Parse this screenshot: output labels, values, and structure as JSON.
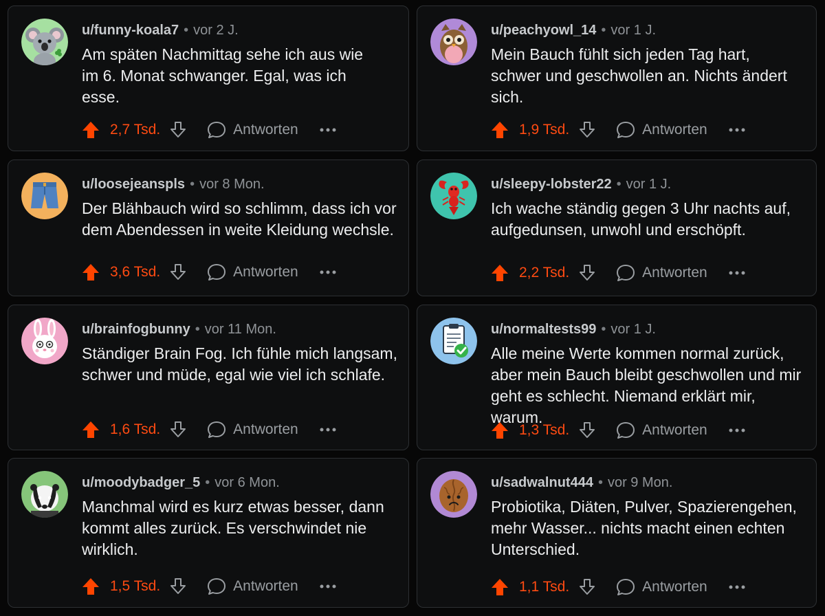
{
  "theme": {
    "accent": "#ff4500",
    "background": "#070707",
    "card": "#0e0f10",
    "border": "#2d3033"
  },
  "comments": [
    {
      "user": "u/funny-koala7",
      "time": "vor 2 J.",
      "lines": [
        "Am späten Nachmittag sehe ich aus wie",
        "im 6. Monat schwanger. Egal, was ich",
        "esse."
      ],
      "votes": "2,7 Tsd.",
      "reply": "Antworten",
      "avatar": "koala-icon"
    },
    {
      "user": "u/peachyowl_14",
      "time": "vor 1 J.",
      "lines": [
        "Mein Bauch fühlt sich jeden Tag hart,",
        "schwer und geschwollen an. Nichts ändert",
        "sich."
      ],
      "votes": "1,9 Tsd.",
      "reply": "Antworten",
      "avatar": "owl-icon"
    },
    {
      "user": "u/loosejeanspls",
      "time": "vor 8 Mon.",
      "lines": [
        "Der Blähbauch wird so schlimm, dass ich vor",
        "dem Abendessen in weite Kleidung wechsle."
      ],
      "votes": "3,6 Tsd.",
      "reply": "Antworten",
      "avatar": "jeans-shorts-icon"
    },
    {
      "user": "u/sleepy-lobster22",
      "time": "vor 1 J.",
      "lines": [
        "Ich wache ständig gegen 3 Uhr nachts auf,",
        "aufgedunsen, unwohl und erschöpft."
      ],
      "votes": "2,2 Tsd.",
      "reply": "Antworten",
      "avatar": "lobster-icon"
    },
    {
      "user": "u/brainfogbunny",
      "time": "vor 11 Mon.",
      "lines": [
        "Ständiger Brain Fog. Ich fühle mich langsam,",
        "schwer und müde, egal wie viel ich schlafe."
      ],
      "votes": "1,6 Tsd.",
      "reply": "Antworten",
      "avatar": "bunny-icon"
    },
    {
      "user": "u/normaltests99",
      "time": "vor 1 J.",
      "lines": [
        "Alle meine Werte kommen normal zurück,",
        "aber mein Bauch bleibt geschwollen und mir",
        "geht es schlecht. Niemand erklärt mir, warum."
      ],
      "votes": "1,3 Tsd.",
      "reply": "Antworten",
      "avatar": "clipboard-check-icon"
    },
    {
      "user": "u/moodybadger_5",
      "time": "vor 6 Mon.",
      "lines": [
        "Manchmal wird es kurz etwas besser, dann",
        "kommt alles zurück. Es verschwindet nie",
        "wirklich."
      ],
      "votes": "1,5 Tsd.",
      "reply": "Antworten",
      "avatar": "badger-icon"
    },
    {
      "user": "u/sadwalnut444",
      "time": "vor 9 Mon.",
      "lines": [
        "Probiotika, Diäten, Pulver, Spazierengehen,",
        "mehr Wasser... nichts macht einen echten",
        "Unterschied."
      ],
      "votes": "1,1 Tsd.",
      "reply": "Antworten",
      "avatar": "walnut-icon"
    }
  ]
}
